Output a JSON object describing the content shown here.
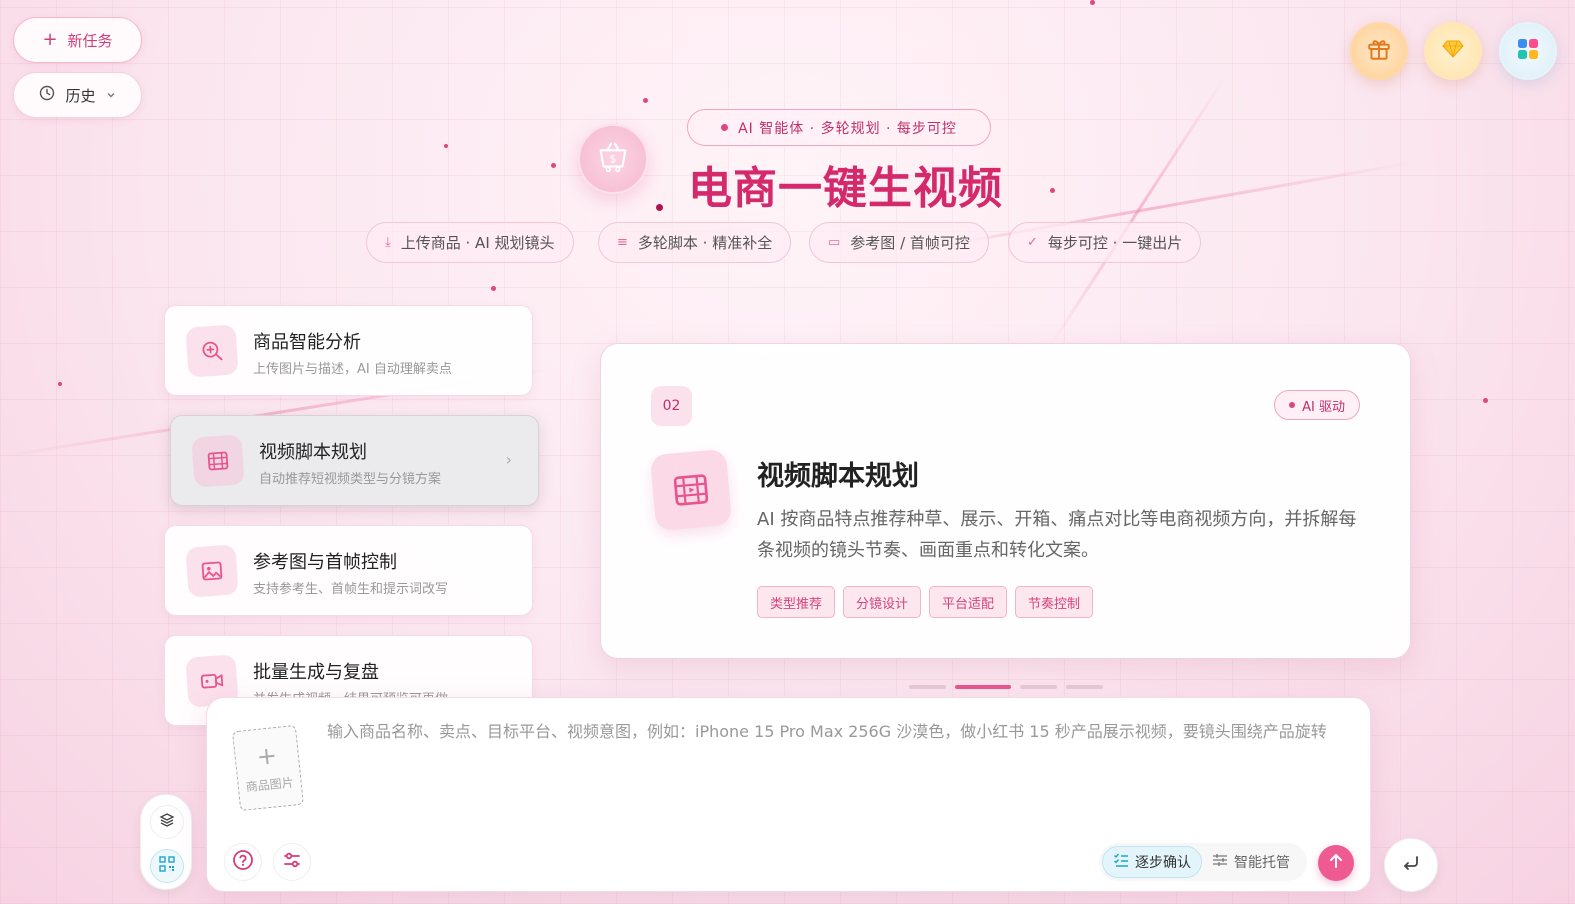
{
  "topbar": {
    "new_task": "新任务",
    "history": "历史",
    "right_icons": [
      "gift-icon",
      "gem-icon",
      "apps-icon"
    ]
  },
  "hero": {
    "tagline": "AI 智能体 · 多轮规划 · 每步可控",
    "title": "电商一键生视频",
    "features": [
      {
        "icon": "download-icon",
        "label": "上传商品 · AI 规划镜头"
      },
      {
        "icon": "lines-icon",
        "label": "多轮脚本 · 精准补全"
      },
      {
        "icon": "play-icon",
        "label": "参考图 / 首帧可控"
      },
      {
        "icon": "check-icon",
        "label": "每步可控 · 一键出片"
      }
    ]
  },
  "steps": [
    {
      "title": "商品智能分析",
      "desc": "上传图片与描述，AI 自动理解卖点",
      "icon": "search-plus-icon"
    },
    {
      "title": "视频脚本规划",
      "desc": "自动推荐短视频类型与分镜方案",
      "icon": "film-icon"
    },
    {
      "title": "参考图与首帧控制",
      "desc": "支持参考生、首帧生和提示词改写",
      "icon": "image-icon"
    },
    {
      "title": "批量生成与复盘",
      "desc": "并发生成视频，结果可预览可再做",
      "icon": "video-icon"
    }
  ],
  "detail": {
    "number": "02",
    "badge": "AI 驱动",
    "title": "视频脚本规划",
    "desc": "AI 按商品特点推荐种草、展示、开箱、痛点对比等电商视频方向，并拆解每条视频的镜头节奏、画面重点和转化文案。",
    "chips": [
      "类型推荐",
      "分镜设计",
      "平台适配",
      "节奏控制"
    ]
  },
  "pager": {
    "count": 4,
    "active_index": 1
  },
  "composer": {
    "upload_label": "商品图片",
    "placeholder": "输入商品名称、卖点、目标平台、视频意图，例如：iPhone 15 Pro Max 256G 沙漠色，做小红书 15 秒产品展示视频，要镜头围绕产品旋转",
    "mode_step": "逐步确认",
    "mode_auto": "智能托管"
  },
  "colors": {
    "accent": "#d42a6c",
    "send": "#ee5a92",
    "chip_text": "#d2457c"
  }
}
